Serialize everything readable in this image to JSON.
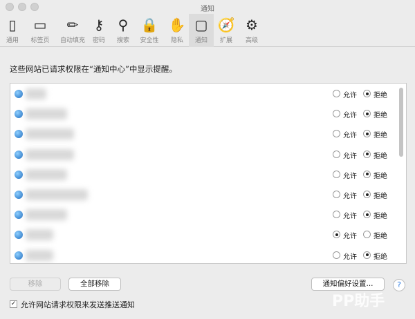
{
  "window": {
    "title": "通知"
  },
  "toolbar": [
    {
      "label": "通用",
      "icon": "switch-icon"
    },
    {
      "label": "标签页",
      "icon": "tabs-icon"
    },
    {
      "label": "自动填充",
      "icon": "pencil-icon"
    },
    {
      "label": "密码",
      "icon": "key-icon"
    },
    {
      "label": "搜索",
      "icon": "search-icon"
    },
    {
      "label": "安全性",
      "icon": "lock-icon"
    },
    {
      "label": "隐私",
      "icon": "hand-icon"
    },
    {
      "label": "通知",
      "icon": "notification-icon",
      "selected": true
    },
    {
      "label": "扩展",
      "icon": "extension-icon"
    },
    {
      "label": "高级",
      "icon": "gear-icon"
    }
  ],
  "heading": "这些网站已请求权限在“通知中心”中显示提醒。",
  "radio_labels": {
    "allow": "允许",
    "deny": "拒绝"
  },
  "sites": [
    {
      "setting": "deny"
    },
    {
      "setting": "deny"
    },
    {
      "setting": "deny"
    },
    {
      "setting": "deny"
    },
    {
      "setting": "deny"
    },
    {
      "setting": "deny"
    },
    {
      "setting": "deny"
    },
    {
      "setting": "allow"
    },
    {
      "setting": "deny"
    }
  ],
  "buttons": {
    "remove": "移除",
    "remove_all": "全部移除",
    "prefs": "通知偏好设置...",
    "help": "?"
  },
  "checkbox": {
    "label": "允许网站请求权限来发送推送通知",
    "checked": true
  },
  "watermark": "PP助手"
}
